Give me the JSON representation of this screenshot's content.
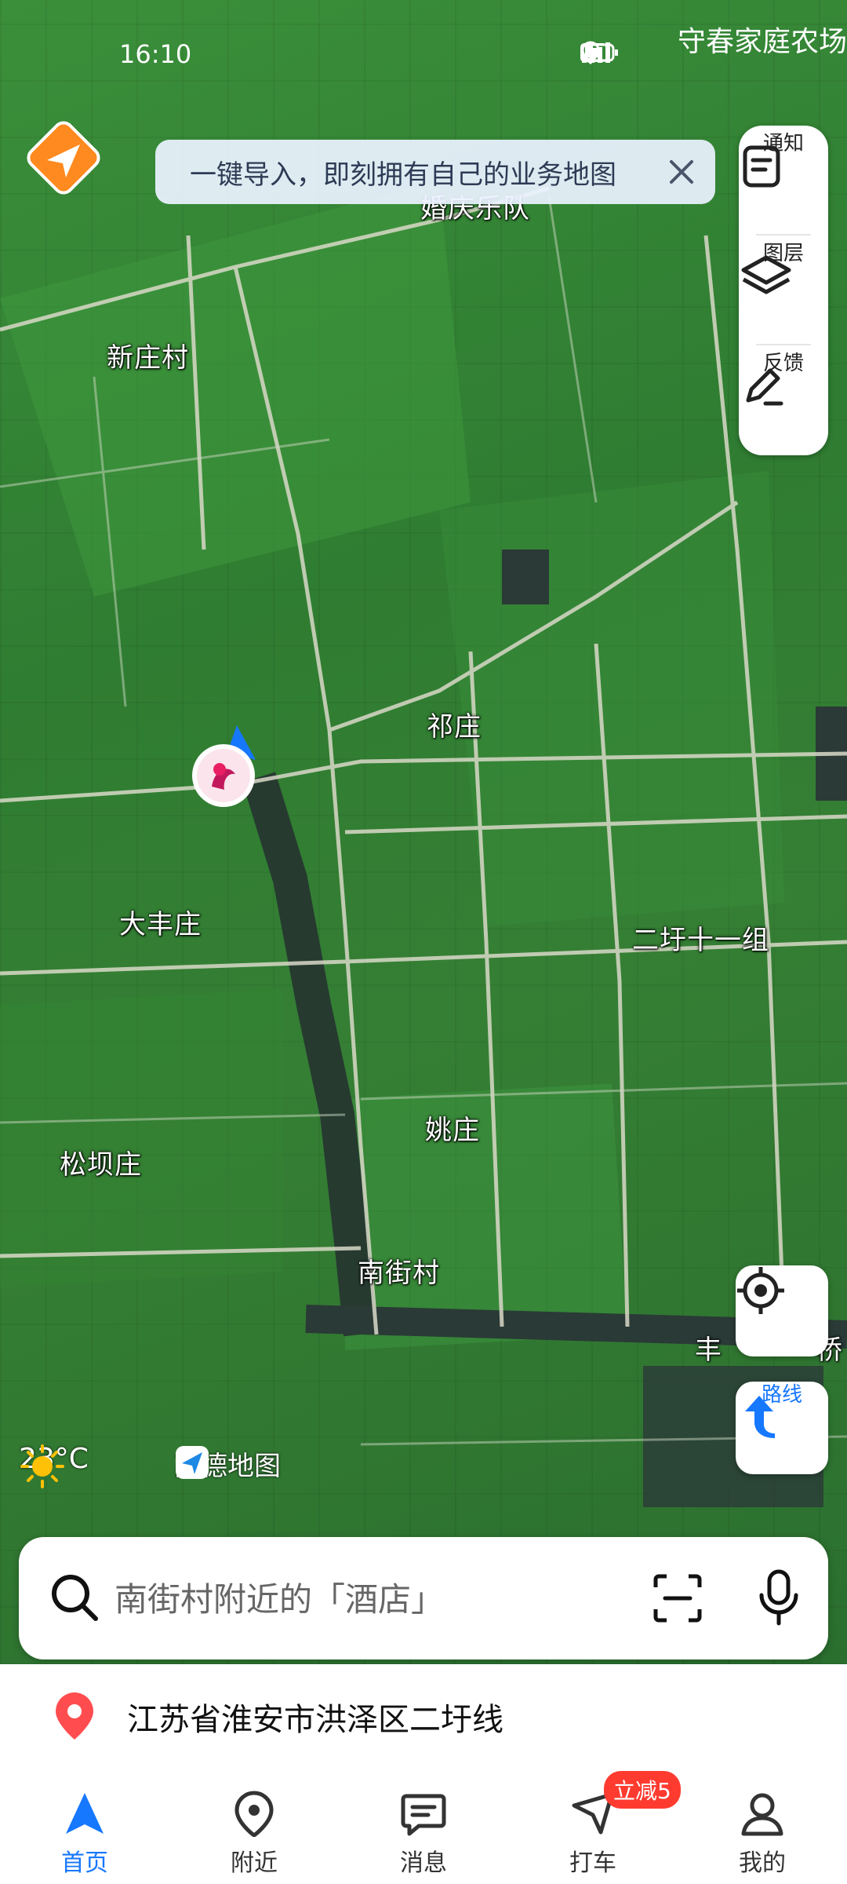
{
  "status_bar": {
    "time": "16:10",
    "top_right_label": "守春家庭农场"
  },
  "banner": {
    "text": "一键导入，即刻拥有自己的业务地图"
  },
  "tools": [
    {
      "label": "通知",
      "icon": "notice-icon"
    },
    {
      "label": "图层",
      "icon": "layers-icon"
    },
    {
      "label": "反馈",
      "icon": "feedback-icon"
    }
  ],
  "map": {
    "places": [
      {
        "name": "婚庆乐队",
        "key": "hunqing"
      },
      {
        "name": "新庄村",
        "key": "xinzhuang"
      },
      {
        "name": "祁庄",
        "key": "qizhuang"
      },
      {
        "name": "大丰庄",
        "key": "dafeng"
      },
      {
        "name": "二圩十一组",
        "key": "erwei"
      },
      {
        "name": "姚庄",
        "key": "yaozhuang"
      },
      {
        "name": "松坝庄",
        "key": "songba"
      },
      {
        "name": "南街村",
        "key": "nanjie"
      },
      {
        "name": "丰",
        "key": "feng"
      },
      {
        "name": "桥",
        "key": "qiao"
      }
    ]
  },
  "route_button": {
    "label": "路线"
  },
  "weather": {
    "temperature": "23°C"
  },
  "brand": {
    "name": "高德地图"
  },
  "search": {
    "placeholder": "南街村附近的「酒店」"
  },
  "address": {
    "text": "江苏省淮安市洪泽区二圩线"
  },
  "nav": {
    "items": [
      {
        "label": "首页",
        "icon": "home-navigation-icon",
        "active": true
      },
      {
        "label": "附近",
        "icon": "nearby-pin-icon"
      },
      {
        "label": "消息",
        "icon": "message-icon"
      },
      {
        "label": "打车",
        "icon": "taxi-icon"
      },
      {
        "label": "我的",
        "icon": "profile-icon"
      }
    ],
    "taxi_badge": "立减5"
  },
  "colors": {
    "accent": "#1677ff",
    "logo_orange": "#ff8a1f",
    "badge_red": "#ff3b30",
    "pin_red": "#ff4d4f"
  }
}
